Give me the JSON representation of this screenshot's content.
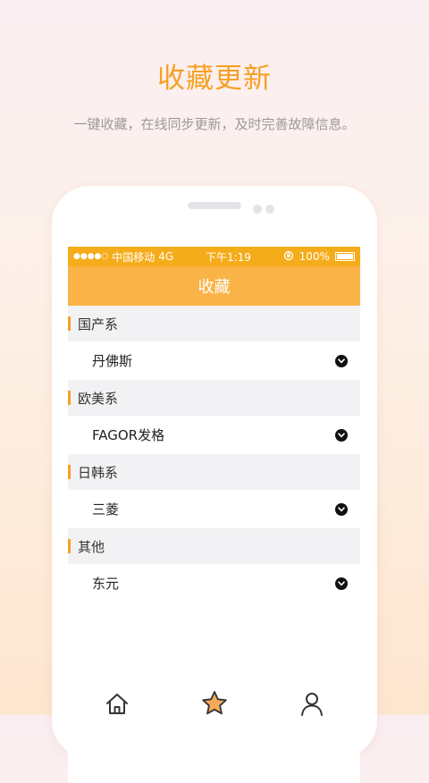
{
  "promo": {
    "title": "收藏更新",
    "subtitle": "一键收藏，在线同步更新，及时完善故障信息。"
  },
  "status_bar": {
    "signal": "●●●●○",
    "carrier": "中国移动",
    "network": "4G",
    "time": "下午1:19",
    "battery": "100%"
  },
  "screen": {
    "title": "收藏",
    "groups": [
      {
        "header": "国产系",
        "item": "丹佛斯"
      },
      {
        "header": "欧美系",
        "item": "FAGOR发格"
      },
      {
        "header": "日韩系",
        "item": "三菱"
      },
      {
        "header": "其他",
        "item": "东元"
      }
    ]
  },
  "tabs": [
    {
      "icon": "home-icon",
      "active": false
    },
    {
      "icon": "star-icon",
      "active": true
    },
    {
      "icon": "user-icon",
      "active": false
    }
  ],
  "colors": {
    "accent": "#f5a125",
    "status_bar": "#f5ac1a",
    "title_bar": "#f9b347",
    "group_bg": "#f2f2f4"
  }
}
